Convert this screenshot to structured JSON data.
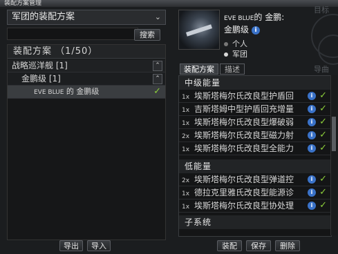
{
  "window": {
    "title": "装配方案管理"
  },
  "left": {
    "dropdown_value": "军团的装配方案",
    "search_button": "搜索",
    "tree_header": "装配方案 （1/50）",
    "tree": [
      {
        "label": "战略巡洋舰 [1]"
      },
      {
        "label": "金鹏级 [1]"
      },
      {
        "prefix": "EVE BLUE",
        "label": "的 金鹏级"
      }
    ],
    "export_button": "导出",
    "import_button": "导入"
  },
  "right": {
    "ship_prefix": "EVE BLUE",
    "ship_name_suffix": "的 金鹏:",
    "ship_class": "金鹏级",
    "radio_personal": "个人",
    "radio_corp": "军团",
    "bg_label_1": "目标",
    "bg_label_2": "导曲",
    "tabs": [
      "装配方案",
      "描述"
    ],
    "sections": [
      {
        "title": "中级能量",
        "modules": [
          {
            "qty": "1x",
            "name": "埃斯塔梅尔氏改良型护盾回"
          },
          {
            "qty": "1x",
            "name": "吉斯塔姆中型护盾回充增量"
          },
          {
            "qty": "1x",
            "name": "埃斯塔梅尔氏改良型爆破弱"
          },
          {
            "qty": "2x",
            "name": "埃斯塔梅尔氏改良型磁力射"
          },
          {
            "qty": "1x",
            "name": "埃斯塔梅尔氏改良型全能力"
          }
        ]
      },
      {
        "title": "低能量",
        "modules": [
          {
            "qty": "2x",
            "name": "埃斯塔梅尔氏改良型弹道控"
          },
          {
            "qty": "1x",
            "name": "德拉克里雅氏改良型能源诊"
          },
          {
            "qty": "1x",
            "name": "埃斯塔梅尔氏改良型协处理"
          }
        ]
      },
      {
        "title": "子系统",
        "modules": []
      }
    ],
    "fit_button": "装配",
    "save_button": "保存",
    "delete_button": "删除"
  },
  "colors": {
    "check": "#8ccf3a",
    "info": "#3a72c8"
  }
}
